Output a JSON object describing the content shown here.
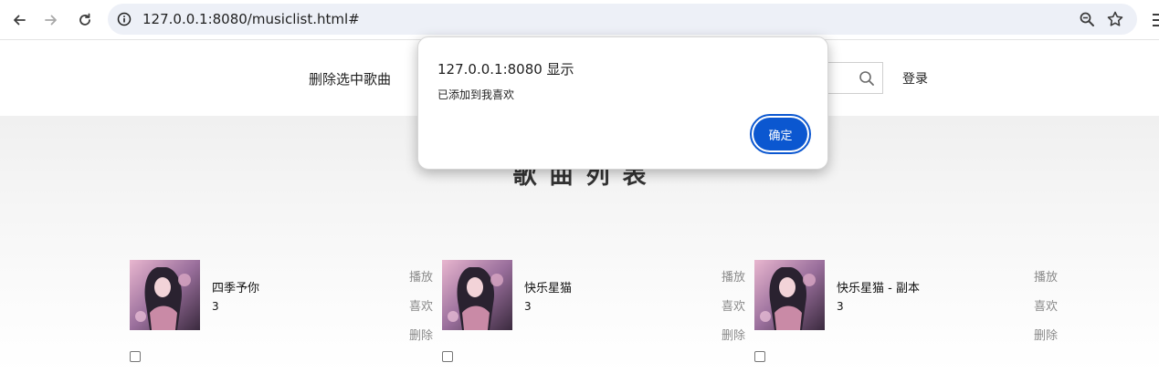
{
  "browser": {
    "url": "127.0.0.1:8080/musiclist.html#",
    "icons": [
      "back-icon",
      "forward-icon",
      "reload-icon",
      "info-icon",
      "zoom-icon",
      "star-icon",
      "menu-icon"
    ]
  },
  "header": {
    "delete_selected_label": "删除选中歌曲",
    "search_placeholder": "",
    "login_label": "登录"
  },
  "main": {
    "title": "歌曲列表",
    "songs": [
      {
        "name": "四季予你",
        "number": "3",
        "play": "播放",
        "like": "喜欢",
        "delete": "删除"
      },
      {
        "name": "快乐星猫",
        "number": "3",
        "play": "播放",
        "like": "喜欢",
        "delete": "删除"
      },
      {
        "name": "快乐星猫 - 副本",
        "number": "3",
        "play": "播放",
        "like": "喜欢",
        "delete": "删除"
      }
    ]
  },
  "dialog": {
    "title": "127.0.0.1:8080 显示",
    "message": "已添加到我喜欢",
    "ok_label": "确定"
  },
  "colors": {
    "accent": "#0b57d0",
    "action_text": "#8a8a8a",
    "omnibox_bg": "#edf0f7"
  }
}
